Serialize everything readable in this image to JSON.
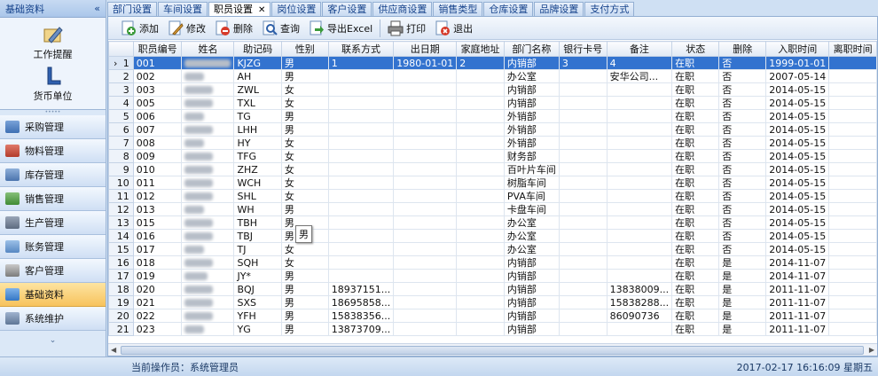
{
  "left_panel": {
    "title": "基础资料",
    "collapse_icon": "«",
    "quick_items": [
      {
        "label": "工作提醒",
        "icon": "pen-icon"
      },
      {
        "label": "货币单位",
        "icon": "l-shape-icon"
      }
    ],
    "nav_items": [
      {
        "label": "采购管理",
        "icon": "cart-icon",
        "active": false
      },
      {
        "label": "物料管理",
        "icon": "boxes-icon",
        "active": false
      },
      {
        "label": "库存管理",
        "icon": "warehouse-icon",
        "active": false
      },
      {
        "label": "销售管理",
        "icon": "sales-icon",
        "active": false
      },
      {
        "label": "生产管理",
        "icon": "factory-icon",
        "active": false
      },
      {
        "label": "账务管理",
        "icon": "ledger-icon",
        "active": false
      },
      {
        "label": "客户管理",
        "icon": "customer-icon",
        "active": false
      },
      {
        "label": "基础资料",
        "icon": "base-data-icon",
        "active": true
      },
      {
        "label": "系统维护",
        "icon": "wrench-icon",
        "active": false
      }
    ],
    "more_icon": "⌄"
  },
  "tabs": [
    {
      "label": "部门设置",
      "active": false
    },
    {
      "label": "车间设置",
      "active": false
    },
    {
      "label": "职员设置",
      "active": true
    },
    {
      "label": "岗位设置",
      "active": false
    },
    {
      "label": "客户设置",
      "active": false
    },
    {
      "label": "供应商设置",
      "active": false
    },
    {
      "label": "销售类型",
      "active": false
    },
    {
      "label": "仓库设置",
      "active": false
    },
    {
      "label": "品牌设置",
      "active": false
    },
    {
      "label": "支付方式",
      "active": false
    }
  ],
  "tab_close": "✕",
  "toolbar": {
    "add": "添加",
    "edit": "修改",
    "delete": "删除",
    "query": "查询",
    "export": "导出Excel",
    "print": "打印",
    "exit": "退出"
  },
  "grid": {
    "columns": [
      "职员编号",
      "姓名",
      "助记码",
      "性别",
      "联系方式",
      "出日期",
      "家庭地址",
      "部门名称",
      "银行卡号",
      "备注",
      "状态",
      "删除",
      "入职时间",
      "离职时间"
    ],
    "current_row_marker": "›",
    "rows": [
      {
        "n": "1",
        "id": "001",
        "code": "KJZG",
        "sex": "男",
        "phone": "1",
        "birth": "1980-01-01",
        "addr": "2",
        "dept": "内销部",
        "bank": "3",
        "note": "4",
        "status": "在职",
        "del": "否",
        "join": "1999-01-01",
        "name_w": 52
      },
      {
        "n": "2",
        "id": "002",
        "code": "AH",
        "sex": "男",
        "phone": "",
        "birth": "",
        "addr": "",
        "dept": "办公室",
        "bank": "",
        "note": "安华公司...",
        "status": "在职",
        "del": "否",
        "join": "2007-05-14",
        "name_w": 22
      },
      {
        "n": "3",
        "id": "003",
        "code": "ZWL",
        "sex": "女",
        "phone": "",
        "birth": "",
        "addr": "",
        "dept": "内销部",
        "bank": "",
        "note": "",
        "status": "在职",
        "del": "否",
        "join": "2014-05-15",
        "name_w": 32
      },
      {
        "n": "4",
        "id": "005",
        "code": "TXL",
        "sex": "女",
        "phone": "",
        "birth": "",
        "addr": "",
        "dept": "内销部",
        "bank": "",
        "note": "",
        "status": "在职",
        "del": "否",
        "join": "2014-05-15",
        "name_w": 32
      },
      {
        "n": "5",
        "id": "006",
        "code": "TG",
        "sex": "男",
        "phone": "",
        "birth": "",
        "addr": "",
        "dept": "外销部",
        "bank": "",
        "note": "",
        "status": "在职",
        "del": "否",
        "join": "2014-05-15",
        "name_w": 22
      },
      {
        "n": "6",
        "id": "007",
        "code": "LHH",
        "sex": "男",
        "phone": "",
        "birth": "",
        "addr": "",
        "dept": "外销部",
        "bank": "",
        "note": "",
        "status": "在职",
        "del": "否",
        "join": "2014-05-15",
        "name_w": 32
      },
      {
        "n": "7",
        "id": "008",
        "code": "HY",
        "sex": "女",
        "phone": "",
        "birth": "",
        "addr": "",
        "dept": "外销部",
        "bank": "",
        "note": "",
        "status": "在职",
        "del": "否",
        "join": "2014-05-15",
        "name_w": 22
      },
      {
        "n": "8",
        "id": "009",
        "code": "TFG",
        "sex": "女",
        "phone": "",
        "birth": "",
        "addr": "",
        "dept": "财务部",
        "bank": "",
        "note": "",
        "status": "在职",
        "del": "否",
        "join": "2014-05-15",
        "name_w": 32
      },
      {
        "n": "9",
        "id": "010",
        "code": "ZHZ",
        "sex": "女",
        "phone": "",
        "birth": "",
        "addr": "",
        "dept": "百叶片车间",
        "bank": "",
        "note": "",
        "status": "在职",
        "del": "否",
        "join": "2014-05-15",
        "name_w": 32
      },
      {
        "n": "10",
        "id": "011",
        "code": "WCH",
        "sex": "女",
        "phone": "",
        "birth": "",
        "addr": "",
        "dept": "树脂车间",
        "bank": "",
        "note": "",
        "status": "在职",
        "del": "否",
        "join": "2014-05-15",
        "name_w": 32
      },
      {
        "n": "11",
        "id": "012",
        "code": "SHL",
        "sex": "女",
        "phone": "",
        "birth": "",
        "addr": "",
        "dept": "PVA车间",
        "bank": "",
        "note": "",
        "status": "在职",
        "del": "否",
        "join": "2014-05-15",
        "name_w": 32
      },
      {
        "n": "12",
        "id": "013",
        "code": "WH",
        "sex": "男",
        "phone": "",
        "birth": "",
        "addr": "",
        "dept": "卡盘车间",
        "bank": "",
        "note": "",
        "status": "在职",
        "del": "否",
        "join": "2014-05-15",
        "name_w": 22
      },
      {
        "n": "13",
        "id": "015",
        "code": "TBH",
        "sex": "男",
        "phone": "",
        "birth": "",
        "addr": "",
        "dept": "办公室",
        "bank": "",
        "note": "",
        "status": "在职",
        "del": "否",
        "join": "2014-05-15",
        "name_w": 32
      },
      {
        "n": "14",
        "id": "016",
        "code": "TBJ",
        "sex": "男",
        "phone": "",
        "birth": "",
        "addr": "",
        "dept": "办公室",
        "bank": "",
        "note": "",
        "status": "在职",
        "del": "否",
        "join": "2014-05-15",
        "name_w": 32
      },
      {
        "n": "15",
        "id": "017",
        "code": "TJ",
        "sex": "女",
        "phone": "",
        "birth": "",
        "addr": "",
        "dept": "办公室",
        "bank": "",
        "note": "",
        "status": "在职",
        "del": "否",
        "join": "2014-05-15",
        "name_w": 22
      },
      {
        "n": "16",
        "id": "018",
        "code": "SQH",
        "sex": "女",
        "phone": "",
        "birth": "",
        "addr": "",
        "dept": "内销部",
        "bank": "",
        "note": "",
        "status": "在职",
        "del": "是",
        "join": "2014-11-07",
        "name_w": 32
      },
      {
        "n": "17",
        "id": "019",
        "code": "JY*",
        "sex": "男",
        "phone": "",
        "birth": "",
        "addr": "",
        "dept": "内销部",
        "bank": "",
        "note": "",
        "status": "在职",
        "del": "是",
        "join": "2014-11-07",
        "name_w": 26
      },
      {
        "n": "18",
        "id": "020",
        "code": "BQJ",
        "sex": "男",
        "phone": "18937151...",
        "birth": "",
        "addr": "",
        "dept": "内销部",
        "bank": "",
        "note": "13838009...",
        "status": "在职",
        "del": "是",
        "join": "2011-11-07",
        "name_w": 32
      },
      {
        "n": "19",
        "id": "021",
        "code": "SXS",
        "sex": "男",
        "phone": "18695858...",
        "birth": "",
        "addr": "",
        "dept": "内销部",
        "bank": "",
        "note": "15838288...",
        "status": "在职",
        "del": "是",
        "join": "2011-11-07",
        "name_w": 32
      },
      {
        "n": "20",
        "id": "022",
        "code": "YFH",
        "sex": "男",
        "phone": "15838356...",
        "birth": "",
        "addr": "",
        "dept": "内销部",
        "bank": "",
        "note": "86090736",
        "status": "在职",
        "del": "是",
        "join": "2011-11-07",
        "name_w": 32
      },
      {
        "n": "21",
        "id": "023",
        "code": "YG",
        "sex": "男",
        "phone": "13873709...",
        "birth": "",
        "addr": "",
        "dept": "内销部",
        "bank": "",
        "note": "",
        "status": "在职",
        "del": "是",
        "join": "2011-11-07",
        "name_w": 22
      }
    ]
  },
  "tooltip": "男",
  "status_bar": {
    "operator": "当前操作员：系统管理员",
    "datetime": "2017-02-17 16:16:09 星期五"
  },
  "colors": {
    "selection": "#3373cf",
    "active_nav": "#f7c35d"
  }
}
